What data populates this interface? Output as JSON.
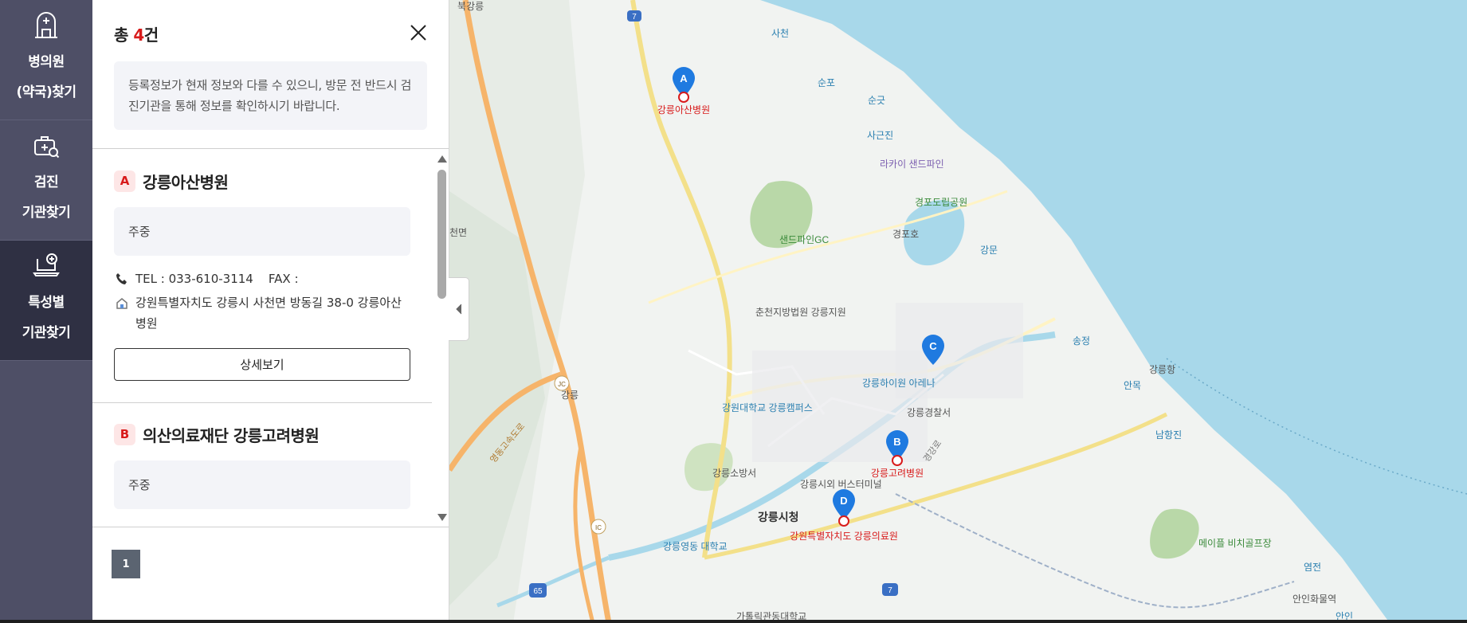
{
  "nav": {
    "items": [
      {
        "line1": "병의원",
        "line2": "(약국)찾기",
        "icon": "hospital-building-icon",
        "active": false
      },
      {
        "line1": "검진",
        "line2": "기관찾기",
        "icon": "medical-kit-search-icon",
        "active": false
      },
      {
        "line1": "특성별",
        "line2": "기관찾기",
        "icon": "laptop-plus-icon",
        "active": true
      }
    ]
  },
  "panel": {
    "total_prefix": "총 ",
    "total_count": "4",
    "total_suffix": "건",
    "close_icon": "close-icon",
    "notice": "등록정보가 현재 정보와 다를 수 있으니, 방문 전 반드시 검진기관을 통해 정보를 확인하시기 바랍니다."
  },
  "results": [
    {
      "marker": "A",
      "name": "강릉아산병원",
      "service": "주중",
      "phone": "TEL : 033-610-3114    FAX :",
      "address": "강원특별자치도 강릉시 사천면 방동길 38-0 강릉아산병원",
      "detail_label": "상세보기"
    },
    {
      "marker": "B",
      "name": "의산의료재단 강릉고려병원",
      "service": "주중"
    }
  ],
  "pagination": {
    "current": "1"
  },
  "colors": {
    "accent": "#d81b1b",
    "nav_bg": "#4e4f66",
    "nav_active": "#2f3043",
    "sea": "#a8d8ea",
    "marker_blue": "#1f7ae0"
  },
  "map": {
    "markers": [
      {
        "letter": "A",
        "label": "강릉아산병원"
      },
      {
        "letter": "B",
        "label": "강릉고려병원"
      },
      {
        "letter": "C",
        "label": ""
      },
      {
        "letter": "D",
        "label": "강원특별자치도 강릉의료원"
      }
    ],
    "places": [
      "사천",
      "순포",
      "순긋",
      "사근진",
      "라카이 샌드파인",
      "경포도립공원",
      "경포호",
      "샌드파인GC",
      "강문",
      "춘천지방법원 강릉지원",
      "송정",
      "강릉하이원 아레나",
      "강릉경찰서",
      "강릉항",
      "안목",
      "남항진",
      "강원대학교 강릉캠퍼스",
      "강릉소방서",
      "강릉시외 버스터미널",
      "강릉시청",
      "강릉영동 대학교",
      "메이플 비치골프장",
      "염전",
      "안인화물역",
      "가톨릭관동대학교",
      "강릉",
      "천면",
      "북강릉",
      "안인"
    ],
    "road_signs": [
      "7",
      "65",
      "7",
      "JC",
      "IC"
    ],
    "expressway": "영동고속도로",
    "street": "경강로"
  }
}
